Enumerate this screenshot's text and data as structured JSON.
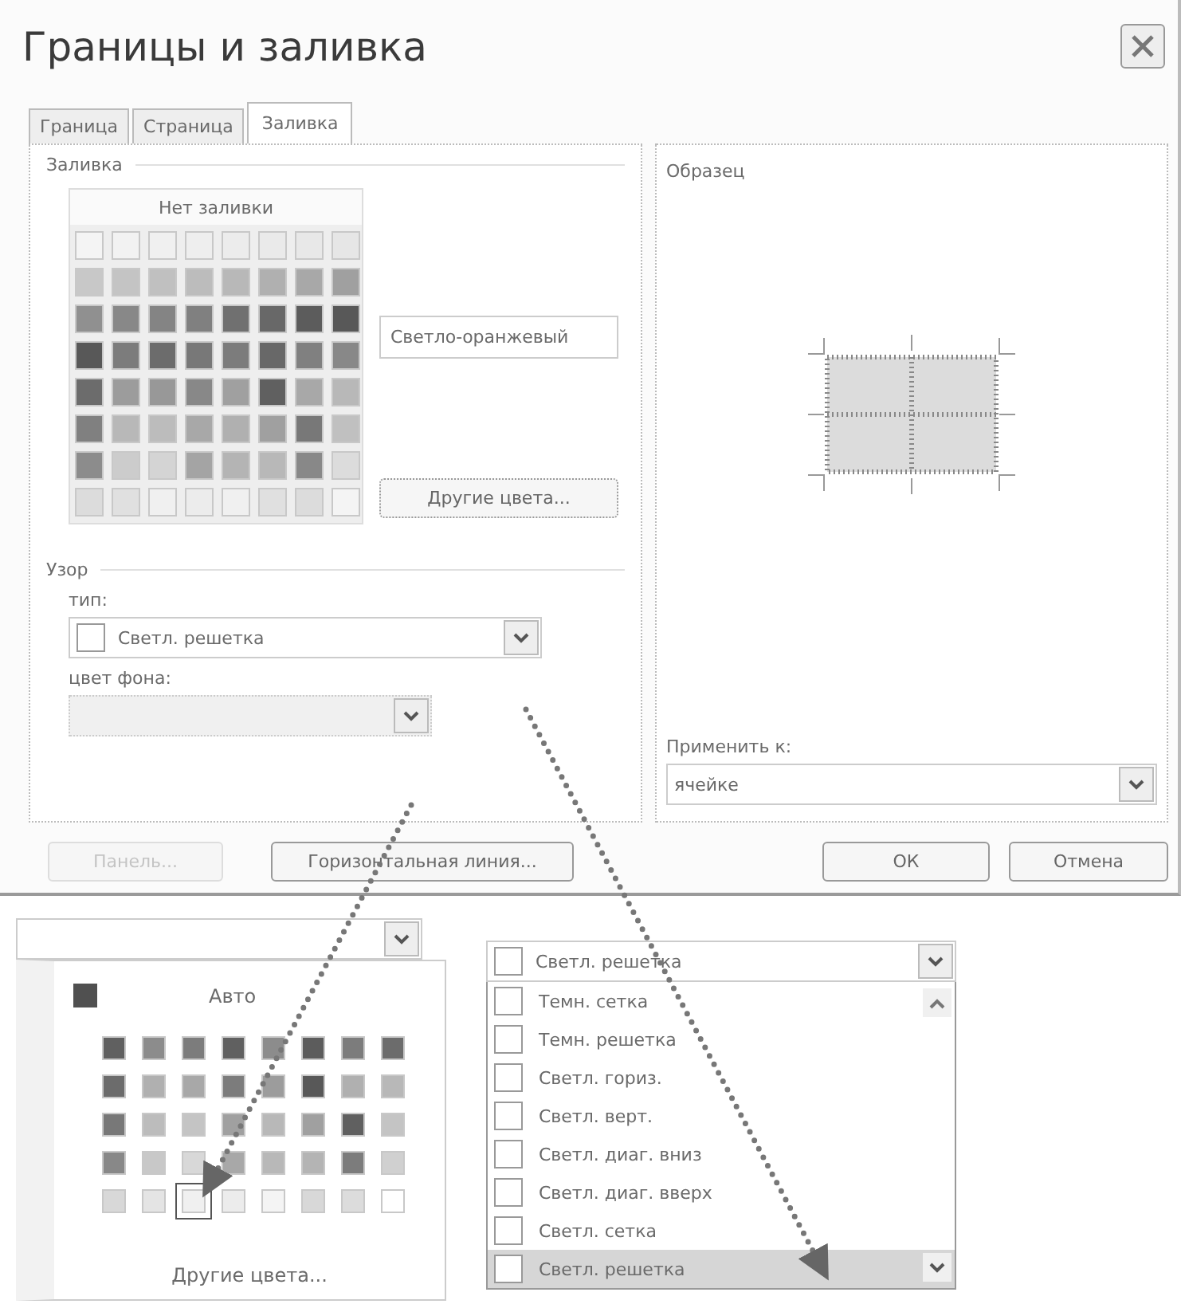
{
  "window": {
    "title": "Границы и заливка"
  },
  "tabs": [
    {
      "label": "Граница",
      "selected": false
    },
    {
      "label": "Страница",
      "selected": false
    },
    {
      "label": "Заливка",
      "selected": true
    }
  ],
  "fill": {
    "legend": "Заливка",
    "no_fill": "Нет заливки",
    "color_name": "Светло-оранжевый",
    "more_colors": "Другие цвета...",
    "palette": [
      [
        {
          "color": "#f4f4f4"
        },
        {
          "color": "#f2f2f2"
        },
        {
          "color": "#f0f0f0"
        },
        {
          "color": "#eeeeee"
        },
        {
          "color": "#ececec"
        },
        {
          "color": "#eaeaea"
        },
        {
          "color": "#e8e8e8"
        },
        {
          "color": "#e6e6e6"
        }
      ],
      [
        {
          "color": "#c8c8c8"
        },
        {
          "color": "#c4c4c4"
        },
        {
          "color": "#c0c0c0"
        },
        {
          "color": "#bcbcbc"
        },
        {
          "color": "#b8b8b8"
        },
        {
          "color": "#b0b0b0"
        },
        {
          "color": "#a8a8a8"
        },
        {
          "color": "#a0a0a0"
        }
      ],
      [
        {
          "color": "#909090"
        },
        {
          "color": "#888888"
        },
        {
          "color": "#848484"
        },
        {
          "color": "#808080"
        },
        {
          "color": "#707070"
        },
        {
          "color": "#686868"
        },
        {
          "color": "#5c5c5c"
        },
        {
          "color": "#585858"
        }
      ],
      [
        {
          "color": "#585858"
        },
        {
          "color": "#7c7c7c"
        },
        {
          "color": "#6c6c6c"
        },
        {
          "color": "#787878"
        },
        {
          "color": "#7c7c7c"
        },
        {
          "color": "#686868"
        },
        {
          "color": "#808080"
        },
        {
          "color": "#888888"
        }
      ],
      [
        {
          "color": "#6c6c6c"
        },
        {
          "color": "#9c9c9c"
        },
        {
          "color": "#989898"
        },
        {
          "color": "#888888"
        },
        {
          "color": "#a0a0a0"
        },
        {
          "color": "#606060"
        },
        {
          "color": "#a8a8a8"
        },
        {
          "color": "#b8b8b8"
        }
      ],
      [
        {
          "color": "#808080"
        },
        {
          "color": "#b8b8b8"
        },
        {
          "color": "#bcbcbc"
        },
        {
          "color": "#a8a8a8"
        },
        {
          "color": "#b0b0b0"
        },
        {
          "color": "#a0a0a0"
        },
        {
          "color": "#787878"
        },
        {
          "color": "#c0c0c0"
        }
      ],
      [
        {
          "color": "#8c8c8c"
        },
        {
          "color": "#cccccc"
        },
        {
          "color": "#d4d4d4"
        },
        {
          "color": "#a4a4a4"
        },
        {
          "color": "#b4b4b4"
        },
        {
          "color": "#b8b8b8"
        },
        {
          "color": "#888888"
        },
        {
          "color": "#dcdcdc"
        }
      ],
      [
        {
          "color": "#dcdcdc"
        },
        {
          "color": "#e0e0e0"
        },
        {
          "color": "#f0f0f0"
        },
        {
          "color": "#ececec"
        },
        {
          "color": "#f0f0f0"
        },
        {
          "color": "#e0e0e0"
        },
        {
          "color": "#dcdcdc"
        },
        {
          "color": "#f4f4f4"
        }
      ]
    ]
  },
  "pattern": {
    "legend": "Узор",
    "type_label": "тип:",
    "type_value": "Светл. решетка",
    "bg_label": "цвет фона:",
    "bg_disabled": true
  },
  "preview": {
    "legend": "Образец",
    "apply_label": "Применить к:",
    "apply_value": "ячейке"
  },
  "left_buttons": [
    {
      "label": "Панель...",
      "disabled": true
    },
    {
      "label": "Горизонтальная линия...",
      "disabled": false
    }
  ],
  "right_buttons": [
    {
      "label": "ОК",
      "disabled": false
    },
    {
      "label": "Отмена",
      "disabled": false
    }
  ],
  "color_popup": {
    "auto_label": "Авто",
    "more_colors": "Другие цвета...",
    "palette": [
      [
        {
          "color": "#606060",
          "selected": false
        },
        {
          "color": "#8c8c8c",
          "selected": false
        },
        {
          "color": "#7c7c7c",
          "selected": false
        },
        {
          "color": "#606060",
          "selected": false
        },
        {
          "color": "#8c8c8c",
          "selected": false
        },
        {
          "color": "#5c5c5c",
          "selected": false
        },
        {
          "color": "#7c7c7c",
          "selected": false
        },
        {
          "color": "#6c6c6c",
          "selected": false
        }
      ],
      [
        {
          "color": "#6c6c6c",
          "selected": false
        },
        {
          "color": "#b0b0b0",
          "selected": false
        },
        {
          "color": "#a8a8a8",
          "selected": false
        },
        {
          "color": "#7c7c7c",
          "selected": false
        },
        {
          "color": "#9c9c9c",
          "selected": false
        },
        {
          "color": "#585858",
          "selected": false
        },
        {
          "color": "#b0b0b0",
          "selected": false
        },
        {
          "color": "#b8b8b8",
          "selected": false
        }
      ],
      [
        {
          "color": "#787878",
          "selected": false
        },
        {
          "color": "#bcbcbc",
          "selected": false
        },
        {
          "color": "#c4c4c4",
          "selected": false
        },
        {
          "color": "#a0a0a0",
          "selected": false
        },
        {
          "color": "#b8b8b8",
          "selected": false
        },
        {
          "color": "#a0a0a0",
          "selected": false
        },
        {
          "color": "#606060",
          "selected": false
        },
        {
          "color": "#c4c4c4",
          "selected": false
        }
      ],
      [
        {
          "color": "#888888",
          "selected": false
        },
        {
          "color": "#c8c8c8",
          "selected": false
        },
        {
          "color": "#d8d8d8",
          "selected": false
        },
        {
          "color": "#a8a8a8",
          "selected": false
        },
        {
          "color": "#b8b8b8",
          "selected": false
        },
        {
          "color": "#b4b4b4",
          "selected": false
        },
        {
          "color": "#7c7c7c",
          "selected": false
        },
        {
          "color": "#d0d0d0",
          "selected": false
        }
      ],
      [
        {
          "color": "#d8d8d8",
          "selected": false
        },
        {
          "color": "#e4e4e4",
          "selected": false
        },
        {
          "color": "#f0f0f0",
          "selected": true
        },
        {
          "color": "#ececec",
          "selected": false
        },
        {
          "color": "#f4f4f4",
          "selected": false
        },
        {
          "color": "#d8d8d8",
          "selected": false
        },
        {
          "color": "#dcdcdc",
          "selected": false
        },
        {
          "color": "#ffffff",
          "selected": false
        }
      ]
    ]
  },
  "pattern_list": {
    "value": "Светл. решетка",
    "items": [
      {
        "label": "Темн. сетка",
        "selected": false
      },
      {
        "label": "Темн. решетка",
        "selected": false
      },
      {
        "label": "Светл. гориз.",
        "selected": false
      },
      {
        "label": "Светл. верт.",
        "selected": false
      },
      {
        "label": "Светл. диаг. вниз",
        "selected": false
      },
      {
        "label": "Светл. диаг. вверх",
        "selected": false
      },
      {
        "label": "Светл. сетка",
        "selected": false
      },
      {
        "label": "Светл. решетка",
        "selected": true
      }
    ]
  }
}
